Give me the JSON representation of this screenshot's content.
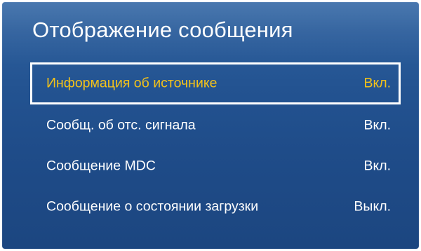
{
  "window": {
    "title": "Отображение сообщения"
  },
  "menu": {
    "items": [
      {
        "label": "Информация об источнике",
        "value": "Вкл.",
        "selected": true
      },
      {
        "label": "Сообщ. об отс. сигнала",
        "value": "Вкл.",
        "selected": false
      },
      {
        "label": "Сообщение MDC",
        "value": "Вкл.",
        "selected": false
      },
      {
        "label": "Сообщение о состоянии загрузки",
        "value": "Выкл.",
        "selected": false
      }
    ]
  },
  "colors": {
    "panel_background": "#2a5a98",
    "selected_text": "#f3c21a",
    "text": "#ffffff",
    "focus_border": "#ffffff"
  }
}
